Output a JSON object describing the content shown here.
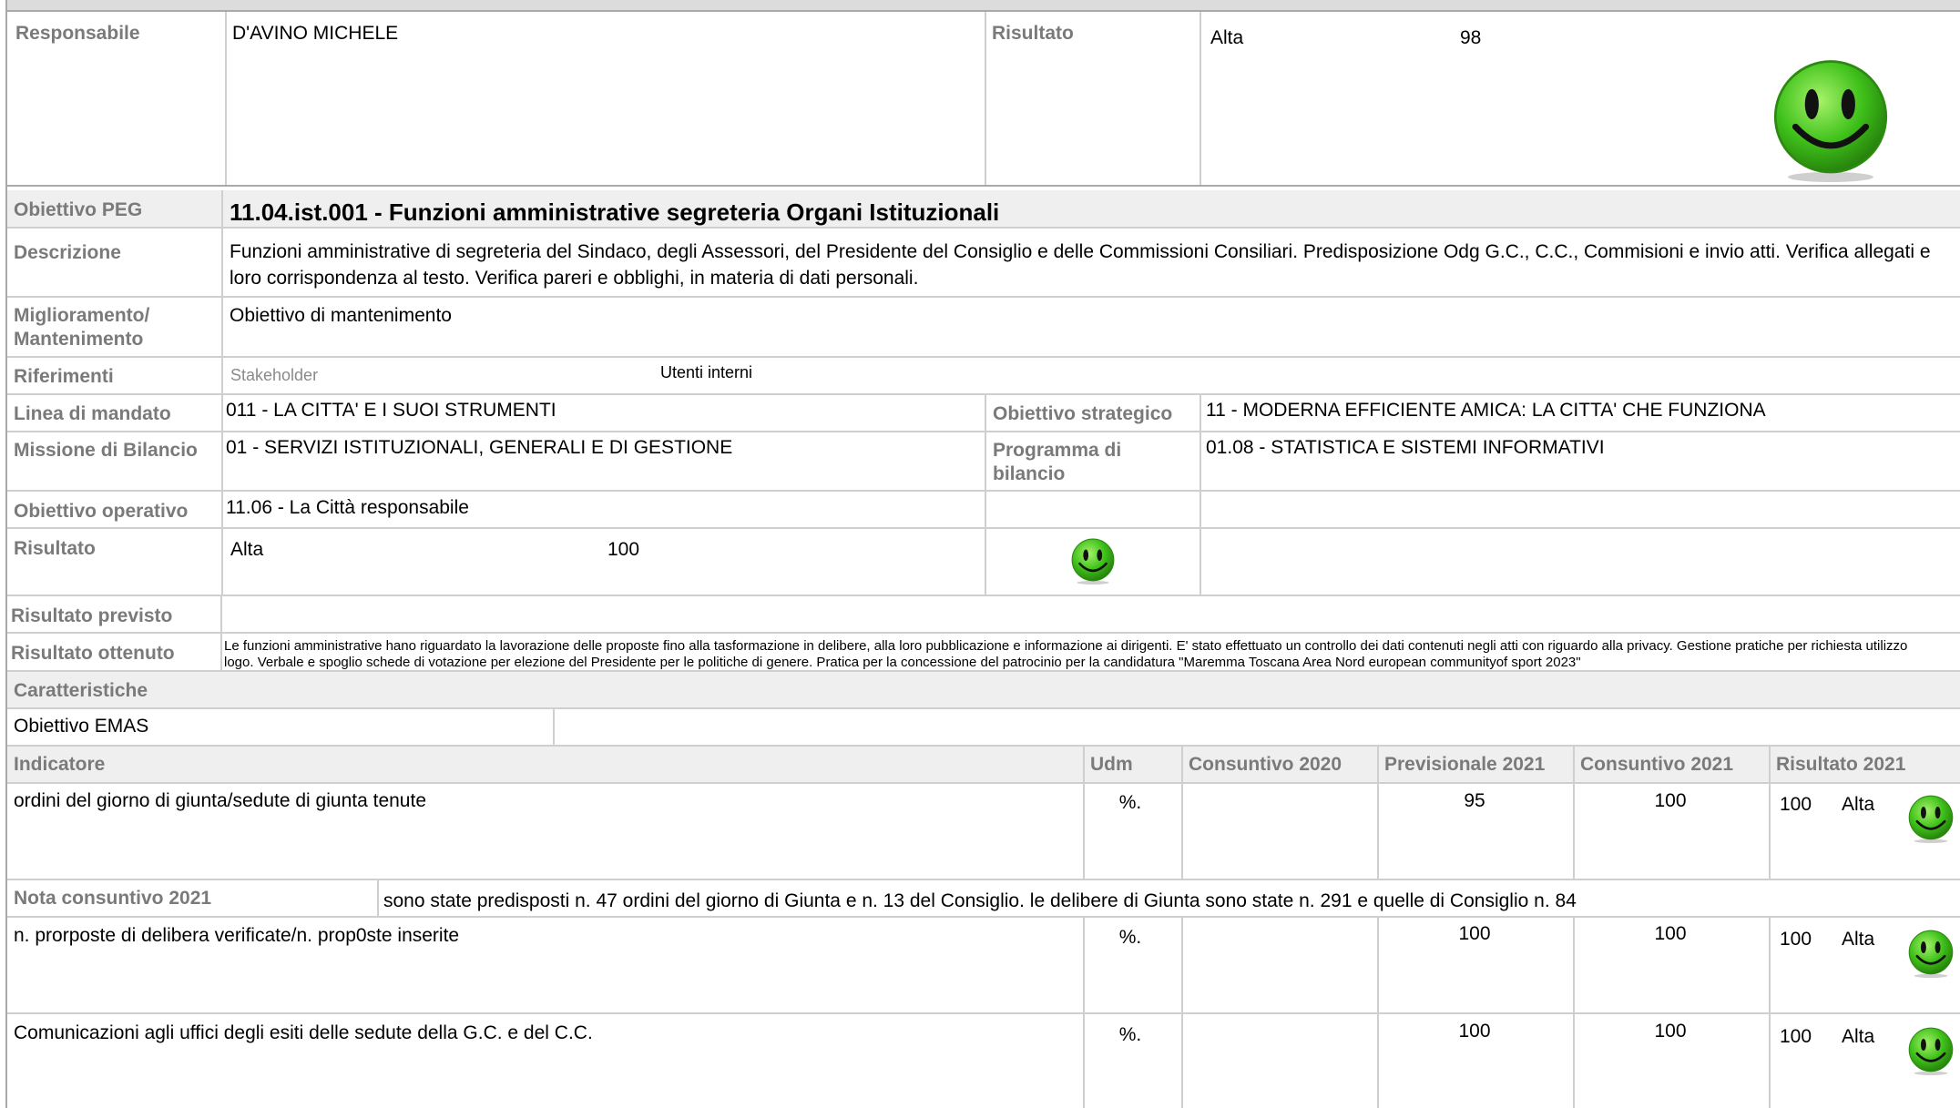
{
  "top": {
    "responsabile_label": "Responsabile",
    "responsabile_value": "D'AVINO MICHELE",
    "risultato_label": "Risultato",
    "risultato_level": "Alta",
    "risultato_score": "98"
  },
  "objective": {
    "peg_label": "Obiettivo PEG",
    "peg_title": "11.04.ist.001 - Funzioni amministrative segreteria Organi Istituzionali",
    "descrizione_label": "Descrizione",
    "descrizione_text": "Funzioni amministrative di segreteria del Sindaco, degli Assessori, del Presidente del Consiglio e delle Commissioni Consiliari. Predisposizione  Odg G.C., C.C.,  Commisioni e invio atti. Verifica allegati e loro corrispondenza al testo. Verifica pareri e obblighi, in materia di dati personali.",
    "miglioramento_label_1": "Miglioramento/",
    "miglioramento_label_2": "Mantenimento",
    "miglioramento_value": "Obiettivo di mantenimento",
    "riferimenti_label": "Riferimenti",
    "stakeholder_label": "Stakeholder",
    "stakeholder_value": "Utenti interni",
    "linea_label": "Linea di mandato",
    "linea_value": "011 - LA CITTA' E I SUOI STRUMENTI",
    "strategico_label": "Obiettivo strategico",
    "strategico_value": "11 - MODERNA EFFICIENTE AMICA: LA CITTA' CHE FUNZIONA",
    "missione_label": "Missione di Bilancio",
    "missione_value": "01 - SERVIZI ISTITUZIONALI, GENERALI E DI GESTIONE",
    "programma_label_1": "Programma di",
    "programma_label_2": "bilancio",
    "programma_value": "01.08 - STATISTICA E SISTEMI INFORMATIVI",
    "operativo_label": "Obiettivo operativo",
    "operativo_value": "11.06 - La Città responsabile",
    "risultato_label": "Risultato",
    "risultato_level": "Alta",
    "risultato_score": "100",
    "previsto_label": "Risultato previsto",
    "ottenuto_label": "Risultato ottenuto",
    "ottenuto_text": "Le funzioni amministrative hano riguardato la lavorazione delle proposte fino alla tasformazione in delibere, alla loro pubblicazione e informazione ai dirigenti. E' stato effettuato un controllo dei dati contenuti negli atti con riguardo alla privacy. Gestione pratiche per richiesta utilizzo logo. Verbale e spoglio schede di votazione per elezione del Presidente per le politiche di genere. Pratica per la concessione del patrocinio per la candidatura \"Maremma Toscana Area Nord european communityof sport 2023\"",
    "caratteristiche_label": "Caratteristiche",
    "emas_label": "Obiettivo EMAS"
  },
  "indicators_table": {
    "headers": [
      "Indicatore",
      "Udm",
      "Consuntivo 2020",
      "Previsionale 2021",
      "Consuntivo 2021",
      "Risultato 2021"
    ],
    "rows": [
      {
        "indicatore": "ordini del giorno di giunta/sedute di giunta tenute",
        "udm": "%.",
        "consuntivo_2020": "",
        "previsionale_2021": "95",
        "consuntivo_2021": "100",
        "risultato_value": "100",
        "risultato_level": "Alta"
      },
      {
        "indicatore": "n. prorposte di delibera verificate/n. prop0ste inserite",
        "udm": "%.",
        "consuntivo_2020": "",
        "previsionale_2021": "100",
        "consuntivo_2021": "100",
        "risultato_value": "100",
        "risultato_level": "Alta"
      },
      {
        "indicatore": "Comunicazioni agli uffici degli esiti delle sedute della G.C. e del C.C.",
        "udm": "%.",
        "consuntivo_2020": "",
        "previsionale_2021": "100",
        "consuntivo_2021": "100",
        "risultato_value": "100",
        "risultato_level": "Alta"
      }
    ],
    "nota_label": "Nota consuntivo 2021",
    "nota_text": "sono state predisposti n. 47 ordini del giorno di Giunta e n. 13 del Consiglio. le delibere di Giunta sono state n. 291 e quelle di Consiglio n. 84"
  },
  "icons": {
    "smiley": "smiley-face-icon",
    "smiley_color": "#3fc11a"
  }
}
